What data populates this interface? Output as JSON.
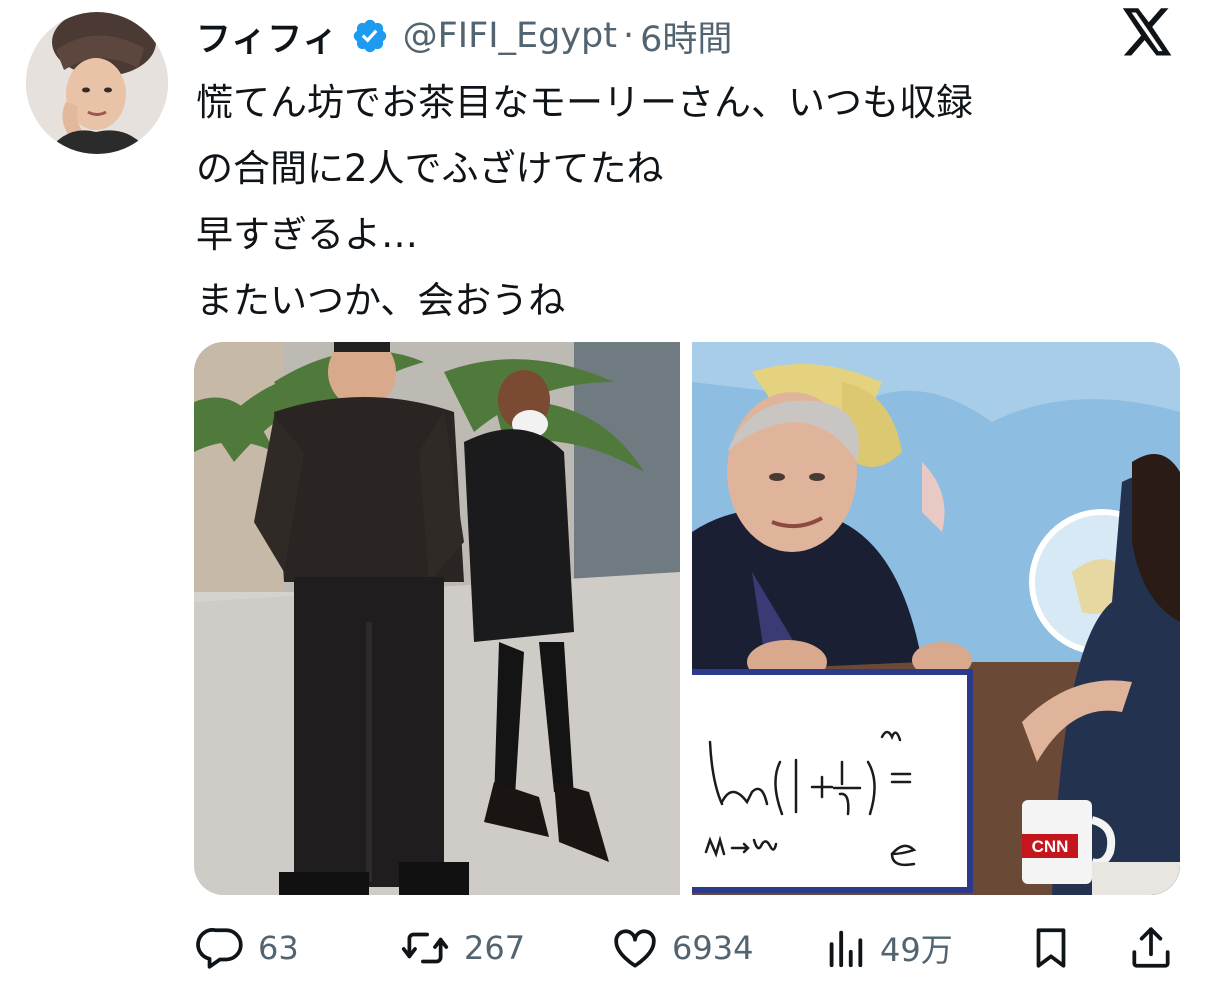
{
  "tweet": {
    "display_name": "フィフィ",
    "handle": "@FIFI_Egypt",
    "separator": "·",
    "time": "6時間",
    "text_lines": [
      "慌てん坊でお茶目なモーリーさん、いつも収録",
      "の合間に2人でふざけてたね",
      "早すぎるよ…",
      "またいつか、会おうね"
    ]
  },
  "media": {
    "left_image": "photo-man-and-woman-in-lobby",
    "right_image": "tv-studio-whiteboard-photo",
    "whiteboard": {
      "limit": "lim",
      "subscript": "m→∞",
      "expression": "(1+ 1/m)",
      "exponent": "m",
      "equals": "=",
      "result": "e"
    },
    "mug_logo": "CNN"
  },
  "actions": {
    "reply_count": "63",
    "retweet_count": "267",
    "like_count": "6934",
    "views_count": "49万"
  },
  "colors": {
    "text": "#0f1419",
    "secondary": "#536471",
    "verified": "#1d9bf0"
  },
  "icons": [
    "verified-badge-icon",
    "x-logo-icon",
    "reply-icon",
    "retweet-icon",
    "like-icon",
    "views-icon",
    "bookmark-icon",
    "share-icon"
  ]
}
